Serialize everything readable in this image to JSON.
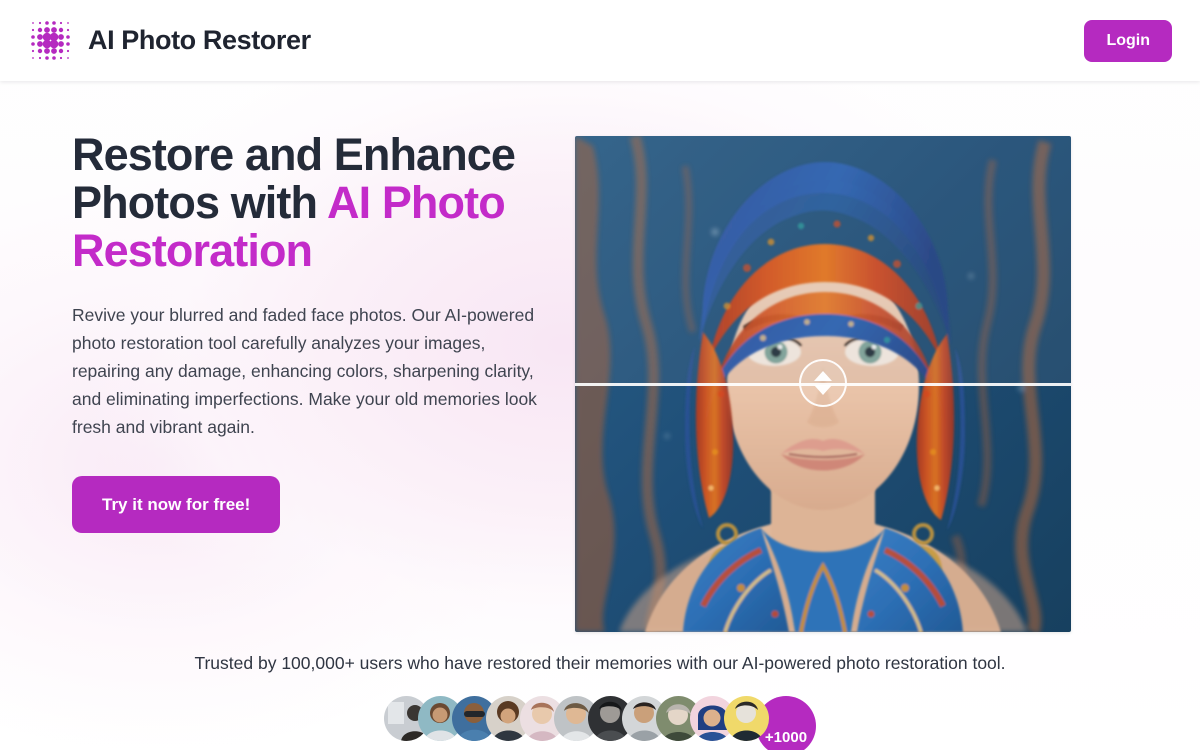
{
  "header": {
    "logo_icon": "dot-grid-logo-icon",
    "brand_name": "AI Photo Restorer",
    "login_label": "Login",
    "accent_color": "#b52ac0"
  },
  "hero": {
    "headline_line1": "Restore and Enhance",
    "headline_line2_plain": "Photos with ",
    "headline_line2_accent": "AI Photo",
    "headline_line3_accent": "Restoration",
    "subcopy": "Revive your blurred and faded face photos. Our AI-powered photo restoration tool carefully analyzes your images, repairing any damage, enhancing colors, sharpening clarity, and eliminating imperfections. Make your old memories look fresh and vibrant again.",
    "cta_label": "Try it now for free!",
    "headline_accent_color": "#c32bc9"
  },
  "compare": {
    "alt": "Before and after portrait of a woman wearing a colorful blue and orange turban with ornate earrings and a patterned blue scarf",
    "handle_icon": "up-down-arrows-icon",
    "divider_position_percent": 50
  },
  "trust": {
    "text": "Trusted by 100,000+ users who have restored their memories with our AI-powered photo restoration tool.",
    "avatar_count": 12,
    "more_badge_label": "+1000"
  }
}
